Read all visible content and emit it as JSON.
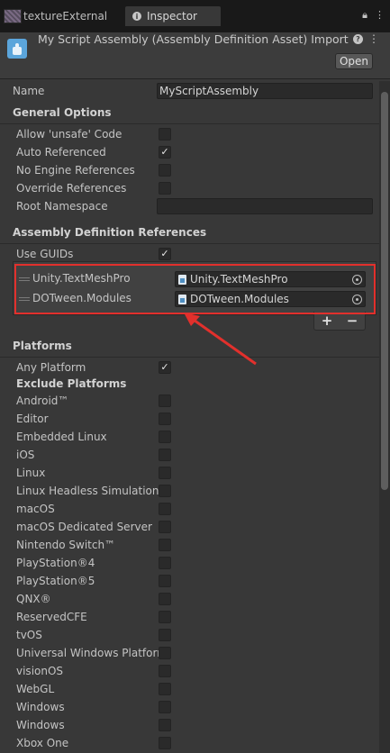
{
  "tabs": [
    {
      "label": "textureExternal",
      "active": false
    },
    {
      "label": "Inspector",
      "active": true
    }
  ],
  "header": {
    "title": "My Script Assembly (Assembly Definition Asset) Import",
    "open_button": "Open"
  },
  "name_field": {
    "label": "Name",
    "value": "MyScriptAssembly"
  },
  "general_options": {
    "title": "General Options",
    "items": [
      {
        "label": "Allow 'unsafe' Code",
        "checked": false
      },
      {
        "label": "Auto Referenced",
        "checked": true
      },
      {
        "label": "No Engine References",
        "checked": false
      },
      {
        "label": "Override References",
        "checked": false
      }
    ],
    "root_namespace": {
      "label": "Root Namespace",
      "value": ""
    }
  },
  "references": {
    "title": "Assembly Definition References",
    "use_guids": {
      "label": "Use GUIDs",
      "checked": true
    },
    "items": [
      {
        "label": "Unity.TextMeshPro",
        "value": "Unity.TextMeshPro"
      },
      {
        "label": "DOTween.Modules",
        "value": "DOTween.Modules"
      }
    ],
    "add": "+",
    "remove": "−"
  },
  "platforms": {
    "title": "Platforms",
    "any_platform": {
      "label": "Any Platform",
      "checked": true
    },
    "exclude_title": "Exclude Platforms",
    "items": [
      {
        "label": "Android™",
        "checked": false
      },
      {
        "label": "Editor",
        "checked": false
      },
      {
        "label": "Embedded Linux",
        "checked": false
      },
      {
        "label": "iOS",
        "checked": false
      },
      {
        "label": "Linux",
        "checked": false
      },
      {
        "label": "Linux Headless Simulation",
        "checked": false
      },
      {
        "label": "macOS",
        "checked": false
      },
      {
        "label": "macOS Dedicated Server",
        "checked": false
      },
      {
        "label": "Nintendo Switch™",
        "checked": false
      },
      {
        "label": "PlayStation®4",
        "checked": false
      },
      {
        "label": "PlayStation®5",
        "checked": false
      },
      {
        "label": "QNX®",
        "checked": false
      },
      {
        "label": "ReservedCFE",
        "checked": false
      },
      {
        "label": "tvOS",
        "checked": false
      },
      {
        "label": "Universal Windows Platform",
        "checked": false
      },
      {
        "label": "visionOS",
        "checked": false
      },
      {
        "label": "WebGL",
        "checked": false
      },
      {
        "label": "Windows",
        "checked": false
      },
      {
        "label": "Windows",
        "checked": false
      },
      {
        "label": "Xbox One",
        "checked": false
      }
    ]
  },
  "colors": {
    "highlight": "#e2302c",
    "background": "#383838"
  }
}
